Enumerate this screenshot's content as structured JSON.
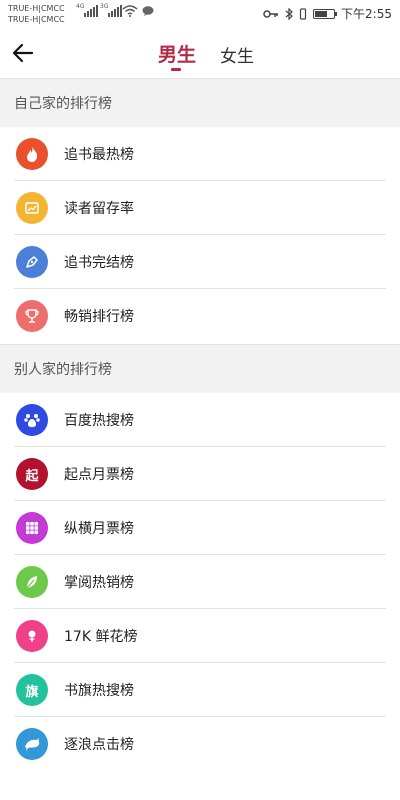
{
  "status_bar": {
    "carrier_1": "TRUE-H|CMCC",
    "carrier_2": "TRUE-H|CMCC",
    "net_1": "4G",
    "net_2": "3G",
    "time": "下午2:55"
  },
  "header": {
    "tab_male": "男生",
    "tab_female": "女生",
    "active_tab": "男生",
    "accent_color": "#b22a46"
  },
  "sections": [
    {
      "title": "自己家的排行榜",
      "items": [
        {
          "label": "追书最热榜",
          "icon": "flame-icon",
          "color": "#e8502e"
        },
        {
          "label": "读者留存率",
          "icon": "chart-icon",
          "color": "#f2b531"
        },
        {
          "label": "追书完结榜",
          "icon": "pen-icon",
          "color": "#4b7fd8"
        },
        {
          "label": "畅销排行榜",
          "icon": "trophy-icon",
          "color": "#ee6d6d"
        }
      ]
    },
    {
      "title": "别人家的排行榜",
      "items": [
        {
          "label": "百度热搜榜",
          "icon": "baidu-paw-icon",
          "color": "#2e4ae0"
        },
        {
          "label": "起点月票榜",
          "icon": "qidian-icon",
          "glyph": "起",
          "color": "#b3122e"
        },
        {
          "label": "纵横月票榜",
          "icon": "grid-icon",
          "color": "#c43ad4"
        },
        {
          "label": "掌阅热销榜",
          "icon": "leaf-icon",
          "color": "#6cc94a"
        },
        {
          "label": "17K 鲜花榜",
          "icon": "flower-icon",
          "color": "#f0408a"
        },
        {
          "label": "书旗热搜榜",
          "icon": "shuqi-icon",
          "glyph": "旗",
          "color": "#22c39c"
        },
        {
          "label": "逐浪点击榜",
          "icon": "dolphin-icon",
          "color": "#3497d8"
        }
      ]
    }
  ]
}
